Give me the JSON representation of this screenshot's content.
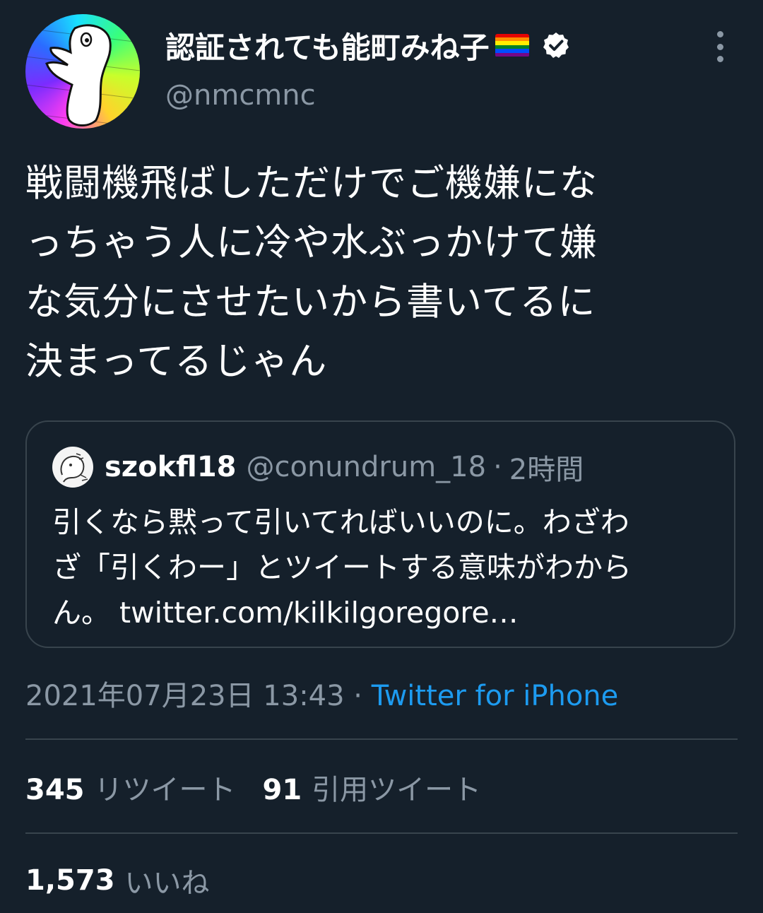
{
  "author": {
    "display_name": "認証されても能町みね子",
    "handle": "@nmcmnc",
    "avatar_icon": "avatar-icon",
    "verified_icon": "verified-badge-icon",
    "flag_icon": "rainbow-flag-icon",
    "flag_colors": [
      "#e40303",
      "#ff8c00",
      "#ffed00",
      "#008026",
      "#004dff",
      "#750787"
    ]
  },
  "menu": {
    "icon": "more-vertical-icon"
  },
  "tweet": {
    "lines": [
      "戦闘機飛ばしただけでご機嫌にな",
      "っちゃう人に冷や水ぶっかけて嫌",
      "な気分にさせたいから書いてるに",
      "決まってるじゃん"
    ]
  },
  "quote": {
    "name": "szokfl18",
    "handle": "@conundrum_18",
    "separator": "·",
    "time": "2時間",
    "lines": [
      "引くなら黙って引いてればいいのに。わざわ",
      "ざ「引くわー」とツイートする意味がわから",
      "ん。 twitter.com/kilkilgoregore…"
    ]
  },
  "meta": {
    "datetime": "2021年07月23日 13:43",
    "separator": " · ",
    "source": "Twitter for iPhone"
  },
  "stats": {
    "retweets_count": "345",
    "retweets_label": "リツイート",
    "quotes_count": "91",
    "quotes_label": "引用ツイート",
    "likes_count": "1,573",
    "likes_label": "いいね"
  },
  "colors": {
    "background": "#15202b",
    "secondary_text": "#8b98a5",
    "accent": "#1d9bf0",
    "border": "#38444d"
  }
}
